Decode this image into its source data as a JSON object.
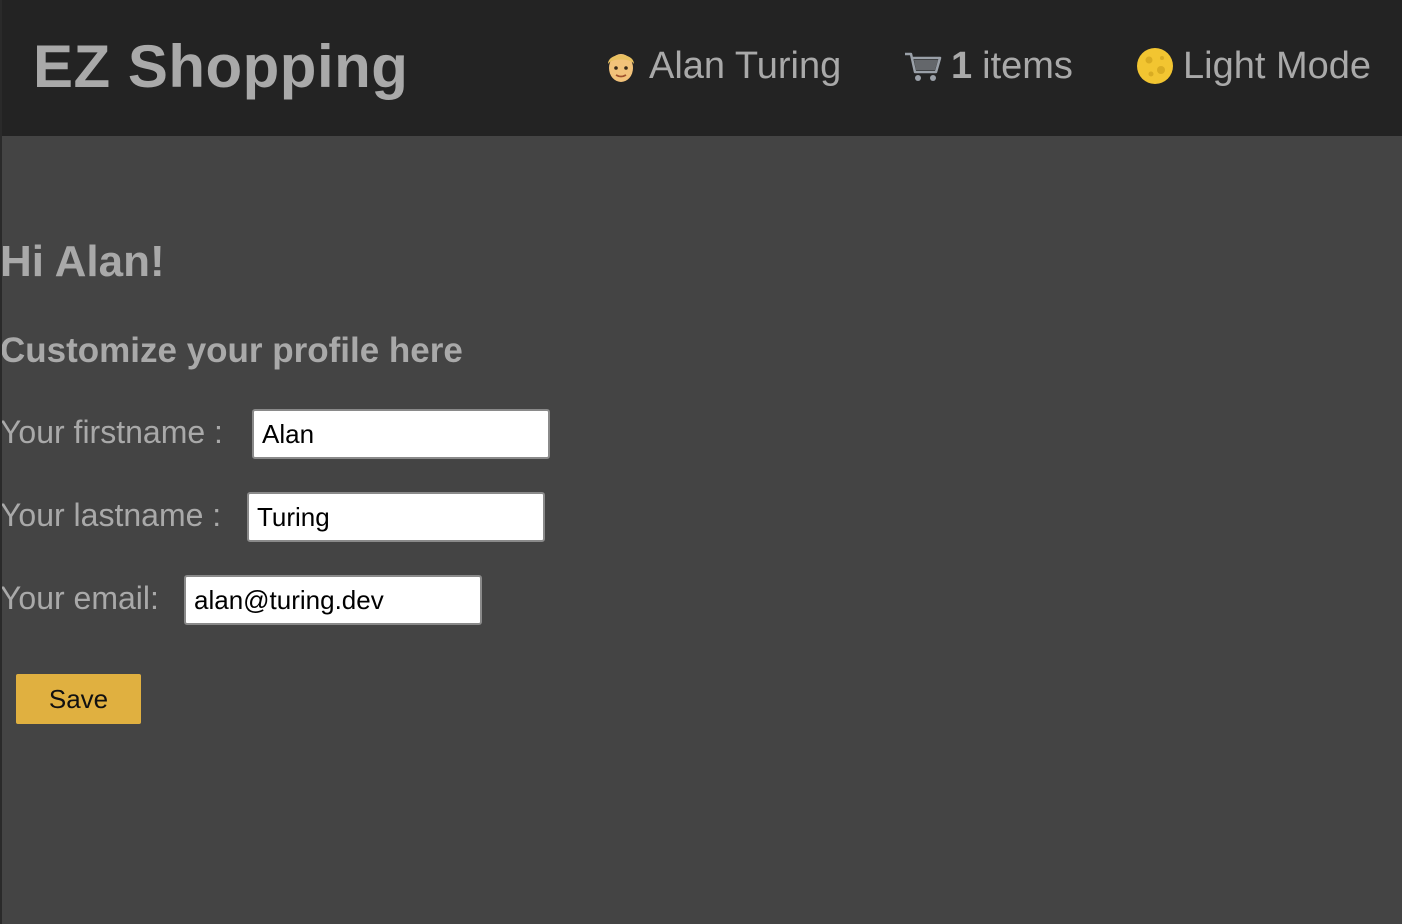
{
  "header": {
    "brand": "EZ Shopping",
    "user": {
      "icon": "person-icon",
      "name": "Alan Turing"
    },
    "cart": {
      "icon": "shopping-cart-icon",
      "count": "1",
      "label": "items"
    },
    "theme_toggle": {
      "icon": "moon-icon",
      "label": "Light Mode"
    }
  },
  "main": {
    "greeting": "Hi Alan!",
    "subtitle": "Customize your profile here",
    "form": {
      "firstname": {
        "label": "Your firstname :",
        "value": "Alan"
      },
      "lastname": {
        "label": "Your lastname :",
        "value": "Turing"
      },
      "email": {
        "label": "Your email:",
        "value": "alan@turing.dev"
      },
      "save_label": "Save"
    }
  },
  "colors": {
    "header_bg": "#232323",
    "page_bg": "#444444",
    "text": "#a9a9a9",
    "accent": "#e0b040"
  }
}
